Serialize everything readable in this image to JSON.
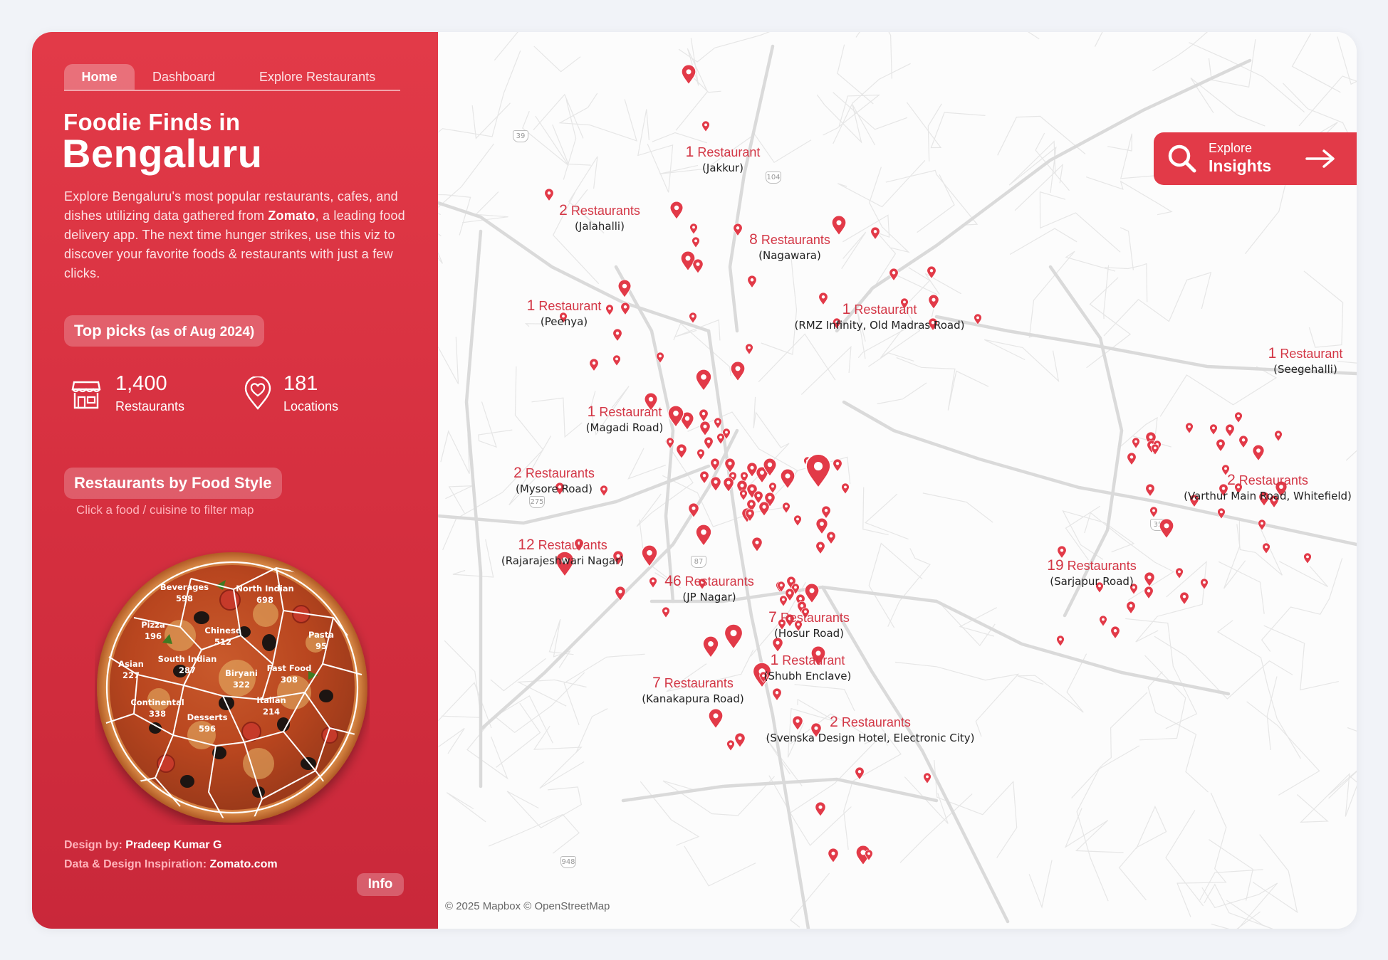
{
  "nav": {
    "home": "Home",
    "dashboard": "Dashboard",
    "explore": "Explore Restaurants"
  },
  "header": {
    "line1": "Foodie Finds in",
    "line2": "Bengaluru"
  },
  "intro": {
    "part1": "Explore Bengaluru's most popular restaurants, cafes, and dishes utilizing data gathered from ",
    "bold": "Zomato",
    "part2": ", a leading food delivery app. The next time hunger strikes, use this viz to discover your favorite foods & restaurants with just a few clicks."
  },
  "top_picks": {
    "label": "Top picks",
    "sub": "(as of Aug 2024)"
  },
  "stats": {
    "restaurants": {
      "value": "1,400",
      "label": "Restaurants",
      "icon": "store-icon"
    },
    "locations": {
      "value": "181",
      "label": "Locations",
      "icon": "location-heart-icon"
    }
  },
  "food_style": {
    "label": "Restaurants by Food Style",
    "hint": "Click a food / cuisine to filter map"
  },
  "cuisines": [
    {
      "name": "Beverages",
      "count": "598"
    },
    {
      "name": "North Indian",
      "count": "698"
    },
    {
      "name": "Pizza",
      "count": "196"
    },
    {
      "name": "Chinese",
      "count": "512"
    },
    {
      "name": "Pasta",
      "count": "95"
    },
    {
      "name": "Asian",
      "count": "227"
    },
    {
      "name": "South Indian",
      "count": "287"
    },
    {
      "name": "Biryani",
      "count": "322"
    },
    {
      "name": "Fast Food",
      "count": "308"
    },
    {
      "name": "Continental",
      "count": "338"
    },
    {
      "name": "Italian",
      "count": "214"
    },
    {
      "name": "Desserts",
      "count": "596"
    }
  ],
  "credits": {
    "design_label": "Design by:",
    "design_name": "Pradeep Kumar G",
    "data_label": "Data & Design Inspiration:",
    "data_name": "Zomato.com",
    "info": "Info"
  },
  "explore_button": {
    "line1": "Explore",
    "line2": "Insights",
    "icon": "search-icon",
    "arrow": "arrow-right-icon"
  },
  "map": {
    "attribution": "© 2025 Mapbox © OpenStreetMap",
    "highways": [
      "39",
      "104",
      "275",
      "35",
      "87",
      "948"
    ],
    "areas": [
      {
        "count": "1",
        "unit": "Restaurant",
        "location": "(Jakkur)"
      },
      {
        "count": "2",
        "unit": "Restaurants",
        "location": "(Jalahalli)"
      },
      {
        "count": "8",
        "unit": "Restaurants",
        "location": "(Nagawara)"
      },
      {
        "count": "1",
        "unit": "Restaurant",
        "location": "(Peenya)"
      },
      {
        "count": "1",
        "unit": "Restaurant",
        "location": "(RMZ Infinity, Old Madras Road)"
      },
      {
        "count": "1",
        "unit": "Restaurant",
        "location": "(Seegehalli)"
      },
      {
        "count": "1",
        "unit": "Restaurant",
        "location": "(Magadi Road)"
      },
      {
        "count": "2",
        "unit": "Restaurants",
        "location": "(Mysore Road)"
      },
      {
        "count": "2",
        "unit": "Restaurants",
        "location": "(Varthur Main Road, Whitefield)"
      },
      {
        "count": "12",
        "unit": "Restaurants",
        "location": "(Rajarajeshwari Nagar)"
      },
      {
        "count": "46",
        "unit": "Restaurants",
        "location": "(JP Nagar)"
      },
      {
        "count": "19",
        "unit": "Restaurants",
        "location": "(Sarjapur Road)"
      },
      {
        "count": "7",
        "unit": "Restaurants",
        "location": "(Hosur Road)"
      },
      {
        "count": "1",
        "unit": "Restaurant",
        "location": "(Shubh Enclave)"
      },
      {
        "count": "7",
        "unit": "Restaurants",
        "location": "(Kanakapura Road)"
      },
      {
        "count": "2",
        "unit": "Restaurants",
        "location": "(Svenska Design Hotel, Electronic City)"
      }
    ]
  },
  "colors": {
    "brand": "#e23a48",
    "label": "#d33645",
    "road": "#e3e3e3"
  }
}
